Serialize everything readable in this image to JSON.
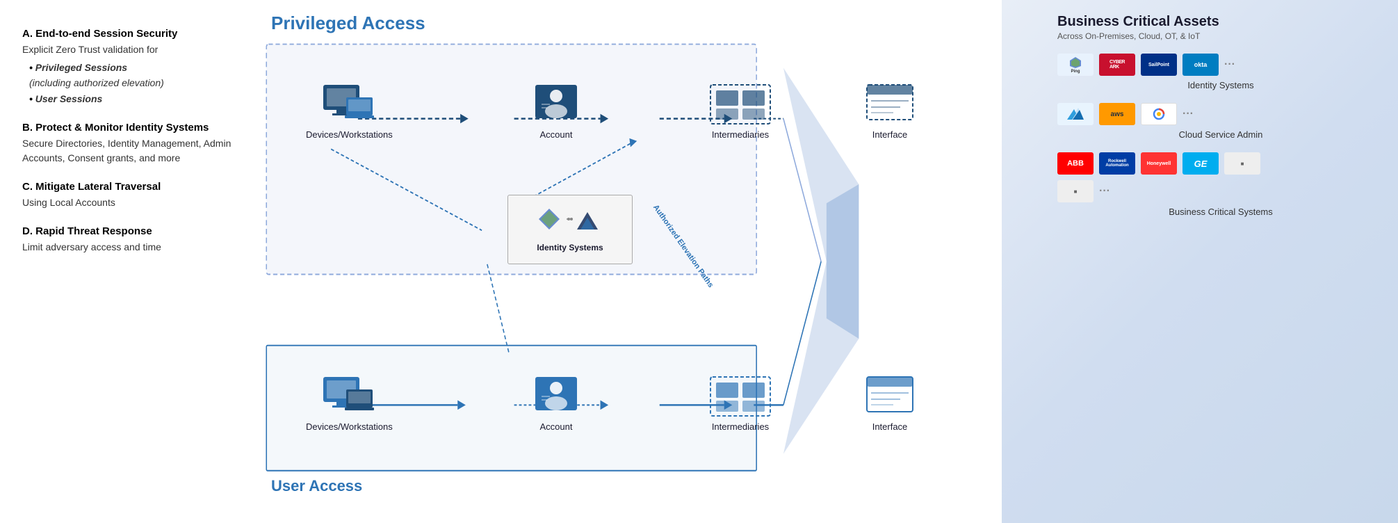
{
  "left": {
    "sections": [
      {
        "id": "A",
        "title": "A. End-to-end Session Security",
        "body": "Explicit Zero Trust validation for",
        "bullets": [
          {
            "text": "Privileged Sessions",
            "sub": "(including authorized elevation)"
          },
          {
            "text": "User Sessions",
            "sub": ""
          }
        ]
      },
      {
        "id": "B",
        "title": "B. Protect & Monitor Identity Systems",
        "body": "Secure Directories, Identity Management, Admin Accounts, Consent grants, and more",
        "bullets": []
      },
      {
        "id": "C",
        "title": "C. Mitigate Lateral Traversal",
        "body": "Using Local Accounts",
        "bullets": []
      },
      {
        "id": "D",
        "title": "D. Rapid Threat Response",
        "body": "Limit adversary access and time",
        "bullets": []
      }
    ]
  },
  "diagram": {
    "title_privileged": "Privileged Access",
    "title_user": "User Access",
    "nodes_privileged": [
      {
        "id": "dev1",
        "label": "Devices/Workstations",
        "type": "device"
      },
      {
        "id": "acc1",
        "label": "Account",
        "type": "account"
      },
      {
        "id": "int1",
        "label": "Intermediaries",
        "type": "intermediaries"
      },
      {
        "id": "ifc1",
        "label": "Interface",
        "type": "interface"
      }
    ],
    "nodes_user": [
      {
        "id": "dev2",
        "label": "Devices/Workstations",
        "type": "device"
      },
      {
        "id": "acc2",
        "label": "Account",
        "type": "account"
      },
      {
        "id": "int2",
        "label": "Intermediaries",
        "type": "intermediaries"
      },
      {
        "id": "ifc2",
        "label": "Interface",
        "type": "interface"
      }
    ],
    "identity_label": "Identity Systems",
    "elevation_label": "Authorized Elevation Paths"
  },
  "bca": {
    "title": "Business Critical Assets",
    "subtitle": "Across On-Premises, Cloud, OT, & IoT",
    "categories": [
      {
        "id": "identity",
        "logos": [
          "Ping",
          "CyberArk",
          "SailPoint",
          "okta",
          "..."
        ],
        "label": "Identity Systems"
      },
      {
        "id": "cloud",
        "logos": [
          "Azure",
          "aws",
          "GCP",
          "..."
        ],
        "label": "Cloud Service Admin"
      },
      {
        "id": "ot",
        "logos": [
          "ABB",
          "Rockwell",
          "Honeywell",
          "GE",
          "..."
        ],
        "label": "Business Critical Systems"
      }
    ]
  }
}
